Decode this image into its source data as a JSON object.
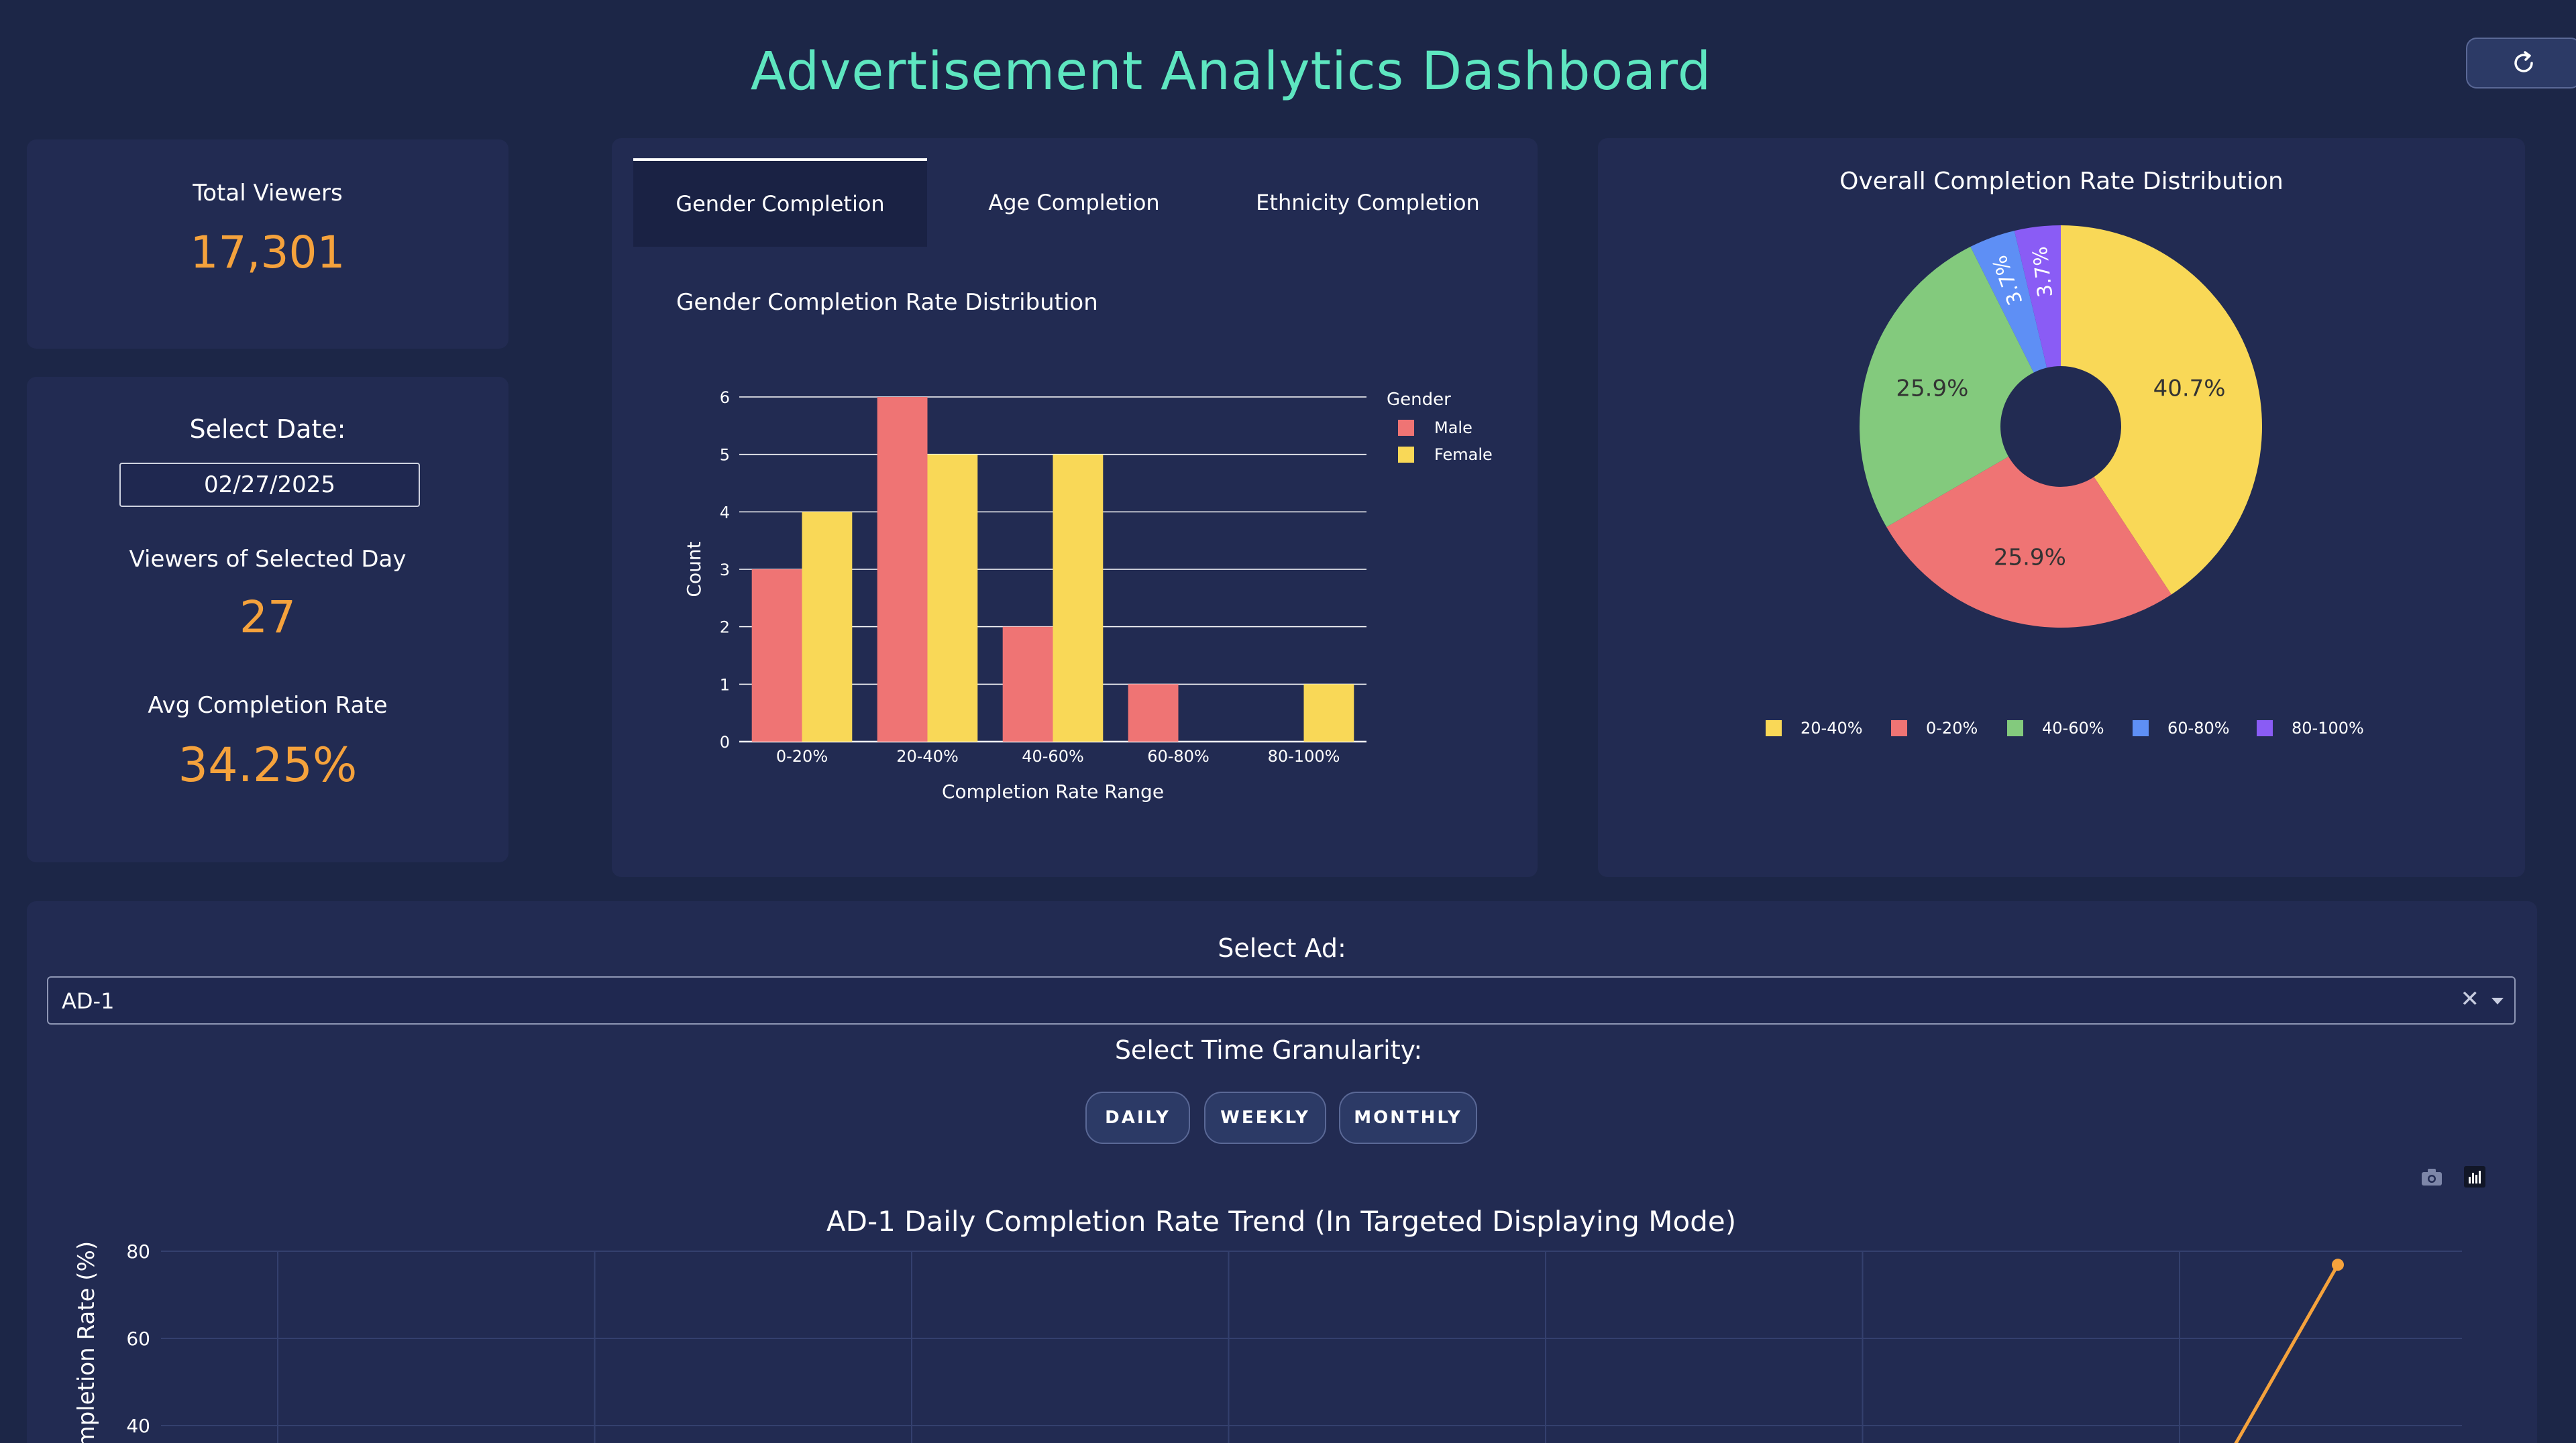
{
  "header": {
    "title": "Advertisement Analytics Dashboard",
    "refresh_icon": "refresh-icon"
  },
  "total_viewers": {
    "label": "Total Viewers",
    "value": "17,301"
  },
  "date_panel": {
    "select_label": "Select Date:",
    "date_value": "02/27/2025",
    "viewers_label": "Viewers of Selected Day",
    "viewers_value": "27",
    "avg_label": "Avg Completion Rate",
    "avg_value": "34.25%"
  },
  "tabs": [
    {
      "label": "Gender Completion",
      "active": true
    },
    {
      "label": "Age Completion",
      "active": false
    },
    {
      "label": "Ethnicity Completion",
      "active": false
    }
  ],
  "colors": {
    "male": "#ef7474",
    "female": "#f9d857",
    "b2040": "#f9d857",
    "b020": "#ef7474",
    "b4060": "#83ca7d",
    "b6080": "#5e8ff5",
    "b80100": "#8a5cf5",
    "trend": "#f5a23c",
    "accent": "#5ee6c0"
  },
  "chart_data": [
    {
      "type": "bar",
      "title": "Gender Completion Rate Distribution",
      "xlabel": "Completion Rate Range",
      "ylabel": "Count",
      "legend_title": "Gender",
      "legend_position": "right",
      "categories": [
        "0-20%",
        "20-40%",
        "40-60%",
        "60-80%",
        "80-100%"
      ],
      "series": [
        {
          "name": "Male",
          "values": [
            3,
            6,
            2,
            1,
            0
          ]
        },
        {
          "name": "Female",
          "values": [
            4,
            5,
            5,
            0,
            1
          ]
        }
      ],
      "ylim": [
        0,
        6
      ],
      "yticks": [
        "0",
        "1",
        "2",
        "3",
        "4",
        "5",
        "6"
      ],
      "grid": true
    },
    {
      "type": "pie",
      "title": "Overall Completion Rate Distribution",
      "hole": true,
      "legend_position": "bottom",
      "slices": [
        {
          "name": "20-40%",
          "value": 40.7,
          "label": "40.7%"
        },
        {
          "name": "0-20%",
          "value": 25.9,
          "label": "25.9%"
        },
        {
          "name": "40-60%",
          "value": 25.9,
          "label": "25.9%"
        },
        {
          "name": "60-80%",
          "value": 3.7,
          "label": "3.7%"
        },
        {
          "name": "80-100%",
          "value": 3.7,
          "label": "3.7%"
        }
      ]
    },
    {
      "type": "line",
      "title": "AD-1 Daily Completion Rate Trend (In Targeted Displaying Mode)",
      "ylabel": "Completion Rate (%)",
      "yticks": [
        "80",
        "60",
        "40"
      ],
      "grid": true,
      "visible_points": [
        {
          "y": 76.9
        }
      ]
    }
  ],
  "ad_section": {
    "select_ad_label": "Select Ad:",
    "ad_value": "AD-1",
    "granularity_label": "Select Time Granularity:",
    "buttons": [
      "DAILY",
      "WEEKLY",
      "MONTHLY"
    ],
    "toolbar_icons": [
      "camera-icon",
      "chart-logo-icon"
    ]
  }
}
